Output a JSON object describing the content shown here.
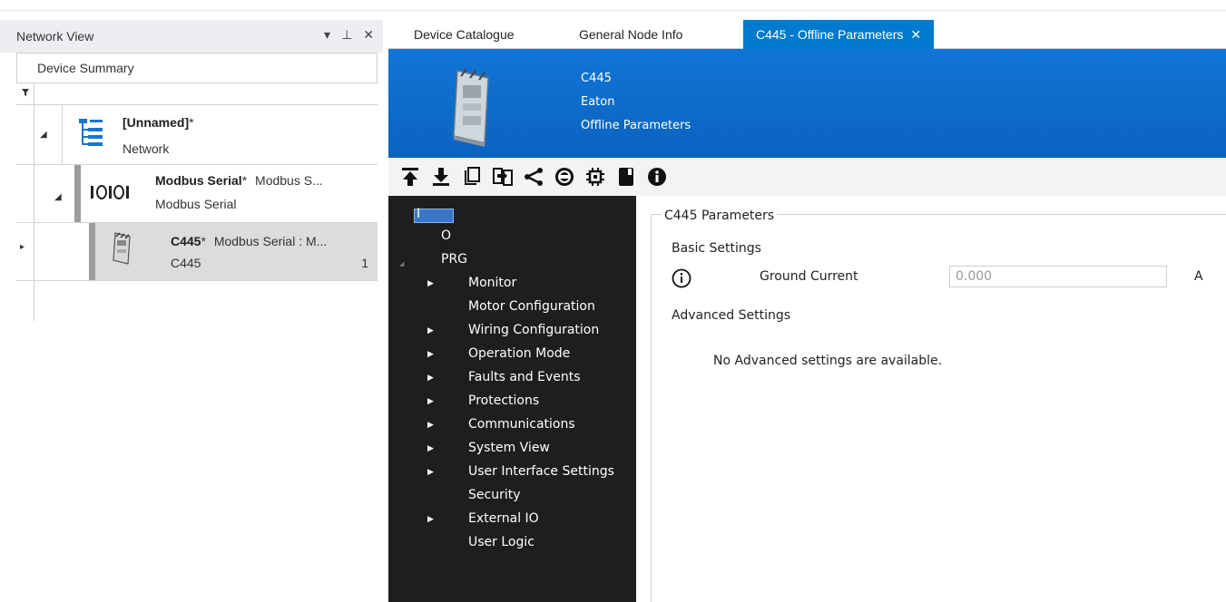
{
  "left_panel": {
    "title": "Network View",
    "controls": {
      "dropdown": "▾",
      "pin": "⊥",
      "close": "✕"
    },
    "column_header": "Device Summary",
    "filter_icon": "funnel-icon",
    "nodes": [
      {
        "name": "[Unnamed]",
        "star": "*",
        "subtitle": "Network",
        "extra": "",
        "number": "",
        "icon": "network-tree-icon",
        "expanded": true
      },
      {
        "name": "Modbus Serial",
        "star": "*",
        "subtitle": "Modbus Serial",
        "extra": "Modbus S...",
        "number": "",
        "icon": "serial-port-icon",
        "expanded": true
      },
      {
        "name": "C445",
        "star": "*",
        "subtitle": "C445",
        "extra": "Modbus Serial : M...",
        "number": "1",
        "icon": "device-icon",
        "expanded": false
      }
    ]
  },
  "tabs": [
    {
      "label": "Device Catalogue",
      "active": false
    },
    {
      "label": "General Node Info",
      "active": false
    },
    {
      "label": "C445 - Offline Parameters",
      "active": true,
      "close": "✕"
    }
  ],
  "device_header": {
    "model": "C445",
    "manufacturer": "Eaton",
    "mode": "Offline Parameters",
    "accent_color": "#0b69c9"
  },
  "toolbar": {
    "buttons": [
      "upload-icon",
      "download-icon",
      "copy-icon",
      "compare-icon",
      "share-icon",
      "record-icon",
      "chip-icon",
      "book-icon",
      "info-icon"
    ]
  },
  "nav_tree": {
    "items": [
      {
        "label": "I",
        "selected": true
      },
      {
        "label": "O"
      },
      {
        "label": "PRG",
        "expanded": true
      },
      {
        "label": "Monitor",
        "expandable": true
      },
      {
        "label": "Motor Configuration",
        "expandable": false
      },
      {
        "label": "Wiring Configuration",
        "expandable": true
      },
      {
        "label": "Operation Mode",
        "expandable": true
      },
      {
        "label": "Faults and Events",
        "expandable": true
      },
      {
        "label": "Protections",
        "expandable": true
      },
      {
        "label": "Communications",
        "expandable": true
      },
      {
        "label": "System View",
        "expandable": true
      },
      {
        "label": "User Interface Settings",
        "expandable": true
      },
      {
        "label": "Security",
        "expandable": false
      },
      {
        "label": "External IO",
        "expandable": true
      },
      {
        "label": "User Logic",
        "expandable": false
      }
    ]
  },
  "params": {
    "group_title": "C445 Parameters",
    "basic_settings": "Basic Settings",
    "ground_current": {
      "label": "Ground Current",
      "value": "0.000",
      "unit": "A"
    },
    "advanced_settings": "Advanced Settings",
    "advanced_message": "No Advanced settings are available."
  }
}
